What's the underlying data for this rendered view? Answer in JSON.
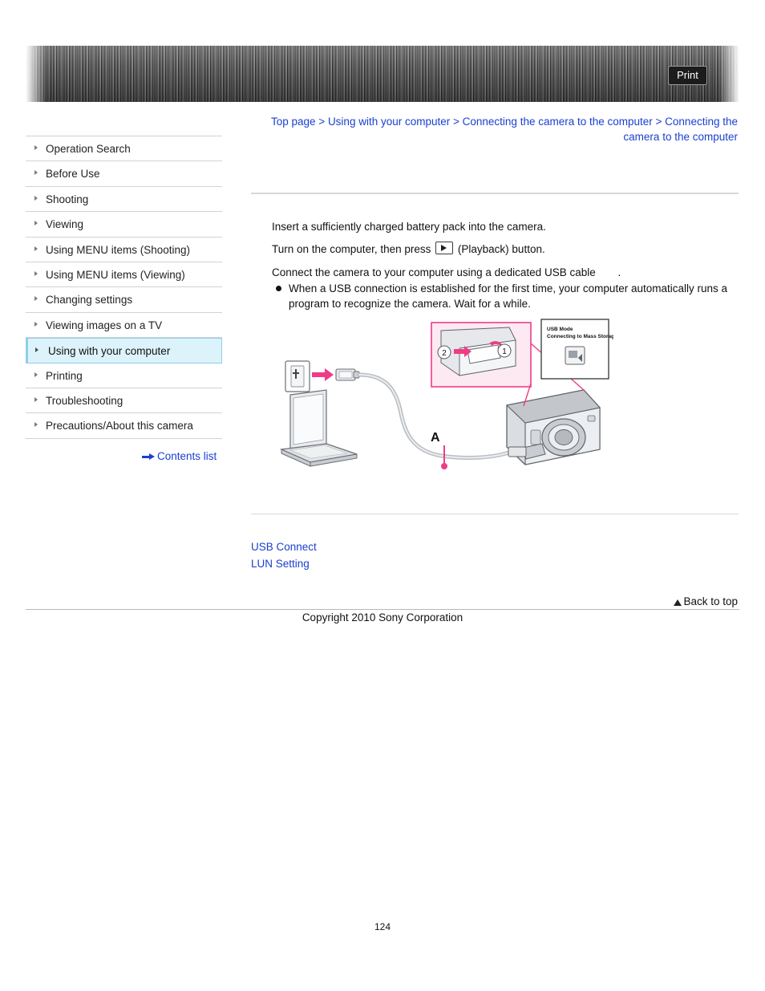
{
  "header": {
    "print_label": "Print"
  },
  "breadcrumb": {
    "items": [
      "Top page",
      "Using with your computer",
      "Connecting the camera to the computer",
      "Connecting the camera to the computer"
    ],
    "separator": ">"
  },
  "sidebar": {
    "items": [
      {
        "label": "Operation Search",
        "active": false
      },
      {
        "label": "Before Use",
        "active": false
      },
      {
        "label": "Shooting",
        "active": false
      },
      {
        "label": "Viewing",
        "active": false
      },
      {
        "label": "Using MENU items (Shooting)",
        "active": false
      },
      {
        "label": "Using MENU items (Viewing)",
        "active": false
      },
      {
        "label": "Changing settings",
        "active": false
      },
      {
        "label": "Viewing images on a TV",
        "active": false
      },
      {
        "label": "Using with your computer",
        "active": true
      },
      {
        "label": "Printing",
        "active": false
      },
      {
        "label": "Troubleshooting",
        "active": false
      },
      {
        "label": "Precautions/About this camera",
        "active": false
      }
    ],
    "contents_list_label": "Contents list"
  },
  "main": {
    "steps": [
      "Insert a sufficiently charged battery pack into the camera.",
      "Turn on the computer, then press",
      "(Playback) button.",
      "Connect the camera to your computer using a dedicated USB cable",
      "."
    ],
    "bullet": "When a USB connection is established for the first time, your computer automatically runs a program to recognize the camera. Wait for a while."
  },
  "figure": {
    "monitor_title": "USB Mode",
    "monitor_subtitle": "Connecting to Mass Storage...",
    "callout_1": "1",
    "callout_2": "2",
    "label_a": "A"
  },
  "bottom_links": [
    {
      "label": "USB Connect"
    },
    {
      "label": "LUN Setting"
    }
  ],
  "footer": {
    "back_to_top": "Back to top",
    "copyright": "Copyright 2010 Sony Corporation",
    "page_number": "124"
  }
}
